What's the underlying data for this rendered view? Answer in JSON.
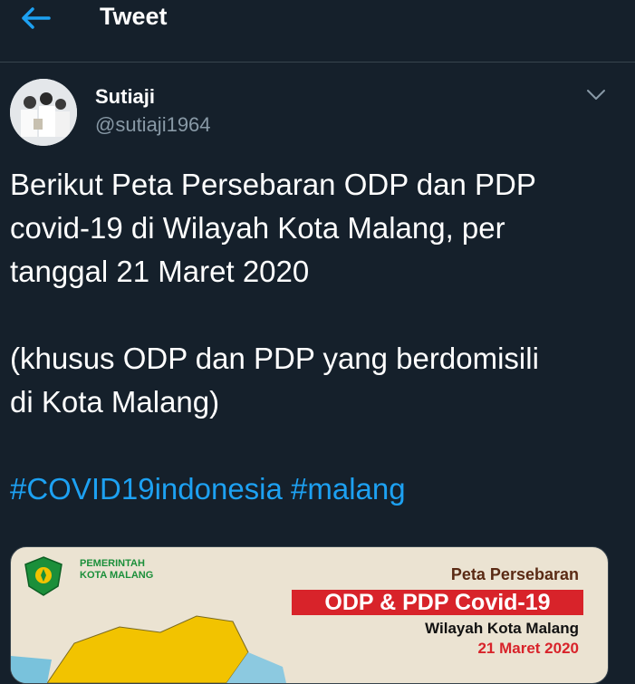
{
  "header": {
    "title": "Tweet",
    "back_icon": "back-arrow-icon"
  },
  "author": {
    "name": "Sutiaji",
    "handle": "@sutiaji1964",
    "menu_icon": "chevron-down-icon"
  },
  "tweet": {
    "para1_line1": "Berikut Peta Persebaran ODP dan PDP",
    "para1_line2": "covid-19 di Wilayah Kota Malang, per",
    "para1_line3": "tanggal 21 Maret 2020",
    "para2_line1": "(khusus ODP dan PDP yang berdomisili",
    "para2_line2": "di Kota Malang)",
    "hashtag1": "#COVID19indonesia",
    "hashtag2": "#malang"
  },
  "media": {
    "gov_line1": "PEMERINTAH",
    "gov_line2": "KOTA MALANG",
    "peta_title": "Peta Persebaran",
    "banner": "ODP & PDP Covid-19",
    "wilayah": "Wilayah Kota Malang",
    "date": "21 Maret 2020"
  },
  "colors": {
    "background": "#15202b",
    "link": "#1da1f2",
    "secondary": "#8899a6",
    "divider": "#38444d"
  }
}
